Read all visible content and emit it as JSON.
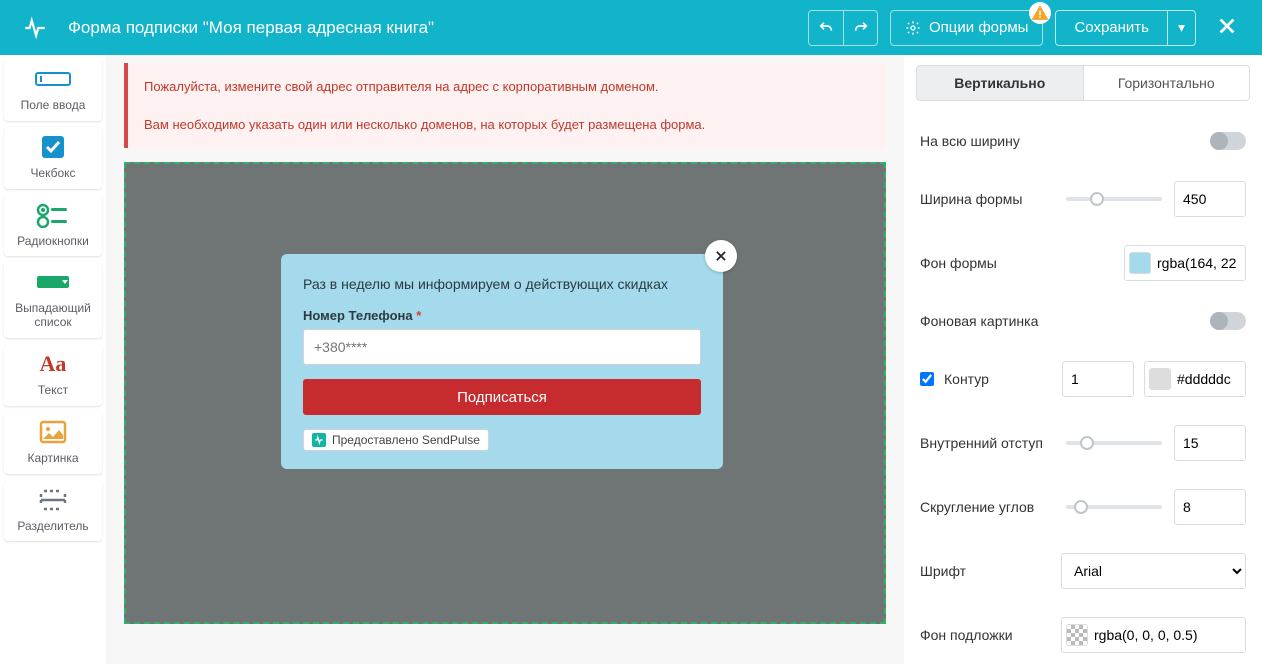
{
  "header": {
    "title": "Форма подписки \"Моя первая адресная книга\"",
    "options_label": "Опции формы",
    "save_label": "Сохранить"
  },
  "palette": [
    {
      "id": "input-field",
      "label": "Поле ввода"
    },
    {
      "id": "checkbox",
      "label": "Чекбокс"
    },
    {
      "id": "radio",
      "label": "Радиокнопки"
    },
    {
      "id": "dropdown",
      "label": "Выпадающий список"
    },
    {
      "id": "text",
      "label": "Текст"
    },
    {
      "id": "image",
      "label": "Картинка"
    },
    {
      "id": "divider",
      "label": "Разделитель"
    }
  ],
  "errors": {
    "line1": "Пожалуйста, измените свой адрес отправителя на адрес с корпоративным доменом.",
    "line2": "Вам необходимо указать один или несколько доменов, на которых будет размещена форма."
  },
  "form_preview": {
    "description": "Раз в неделю мы информируем о действующих скидках",
    "field_label": "Номер Телефона",
    "required_marker": "*",
    "placeholder": "+380****",
    "submit_label": "Подписаться",
    "powered_by": "Предоставлено SendPulse"
  },
  "props": {
    "tabs": {
      "vertical": "Вертикально",
      "horizontal": "Горизонтально",
      "active": "vertical"
    },
    "full_width": {
      "label": "На всю ширину",
      "value": false
    },
    "form_width": {
      "label": "Ширина формы",
      "value": "450"
    },
    "form_bg": {
      "label": "Фон формы",
      "value": "rgba(164, 22",
      "swatch": "#a4daeb"
    },
    "bg_image": {
      "label": "Фоновая картинка",
      "value": false
    },
    "outline": {
      "label": "Контур",
      "checked": true,
      "width": "1",
      "color": "#dddddc",
      "swatch": "#dddddd"
    },
    "padding": {
      "label": "Внутренний отступ",
      "value": "15"
    },
    "radius": {
      "label": "Скругление углов",
      "value": "8"
    },
    "font": {
      "label": "Шрифт",
      "value": "Arial"
    },
    "overlay": {
      "label": "Фон подложки",
      "value": "rgba(0, 0, 0, 0.5)"
    }
  }
}
